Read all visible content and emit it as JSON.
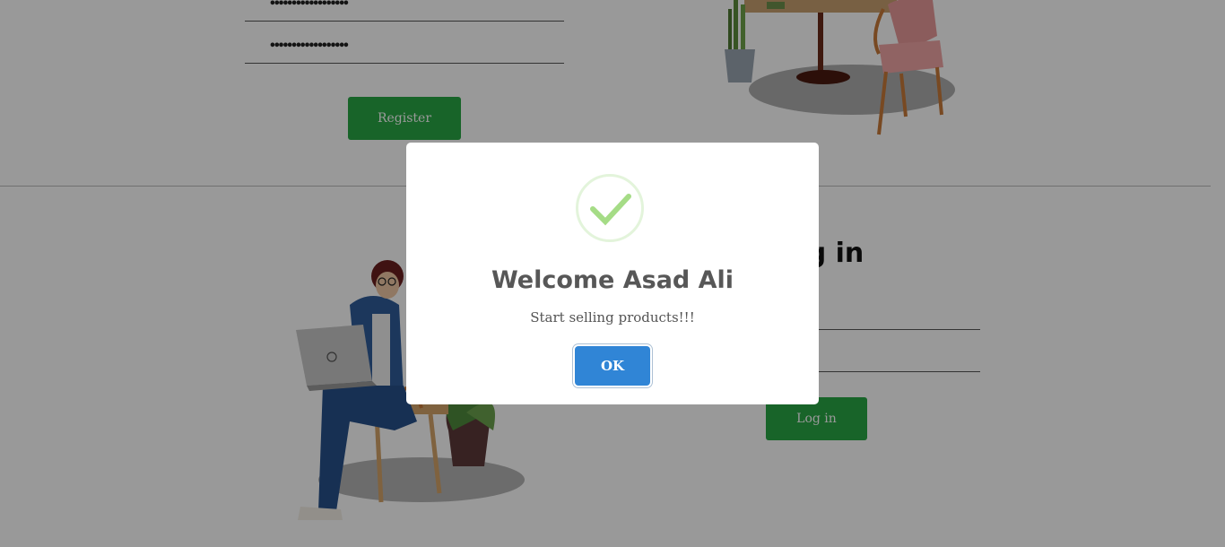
{
  "register": {
    "password_value": "••••••••••••••••••",
    "confirm_password_value": "••••••••••••••••••",
    "register_label": "Register"
  },
  "login": {
    "heading": "Log in",
    "login_label": "Log in"
  },
  "modal": {
    "title": "Welcome Asad Ali",
    "text": "Start selling products!!!",
    "ok_label": "OK",
    "icon": "checkmark-icon"
  },
  "colors": {
    "primary_green": "#28a745",
    "ok_blue": "#3085d6",
    "success_green": "#a5dc86"
  }
}
